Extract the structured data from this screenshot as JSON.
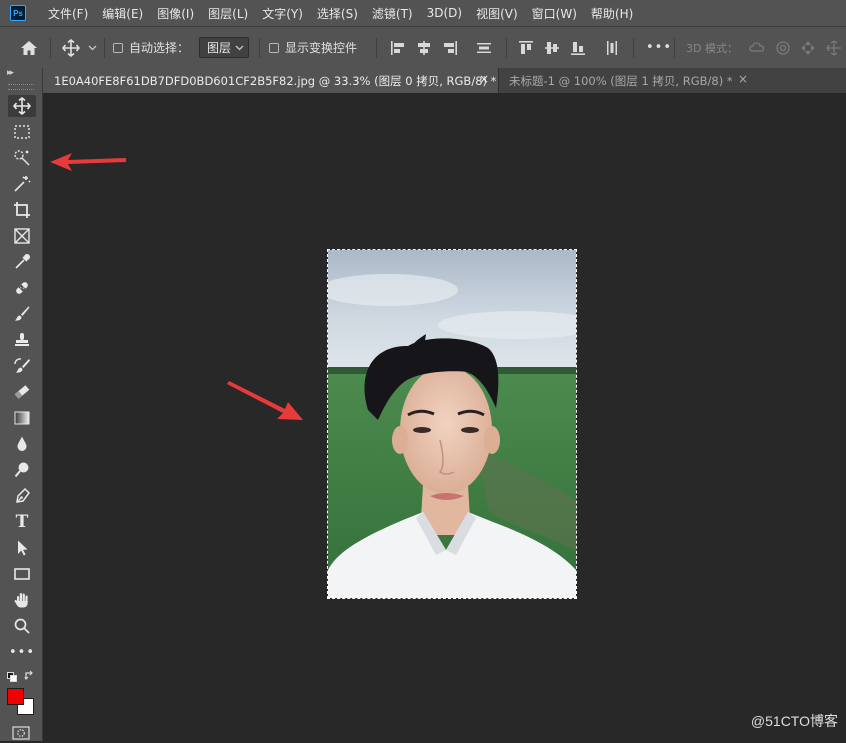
{
  "app": {
    "logo_text": "Ps"
  },
  "menu": [
    "文件(F)",
    "编辑(E)",
    "图像(I)",
    "图层(L)",
    "文字(Y)",
    "选择(S)",
    "滤镜(T)",
    "3D(D)",
    "视图(V)",
    "窗口(W)",
    "帮助(H)"
  ],
  "options": {
    "auto_select_label": "自动选择：",
    "auto_select_target": "图层",
    "show_transform_label": "显示变换控件",
    "more_label": "•••",
    "mode_3d_label": "3D 模式："
  },
  "tabs": [
    {
      "title": "1E0A40FE8F61DB7DFD0BD601CF2B5F82.jpg @ 33.3% (图层 0 拷贝, RGB/8) *",
      "close": "×"
    },
    {
      "title": "未标题-1 @ 100% (图层 1 拷贝, RGB/8) *",
      "close": "×"
    }
  ],
  "toolbar": {
    "collapse": "▸▸",
    "tools": [
      "move-icon",
      "rect-marquee-icon",
      "quick-selection-icon",
      "magic-wand-icon",
      "crop-icon",
      "frame-icon",
      "eyedropper-icon",
      "healing-brush-icon",
      "brush-icon",
      "clone-stamp-icon",
      "history-brush-icon",
      "eraser-icon",
      "gradient-icon",
      "blur-icon",
      "dodge-icon",
      "pen-icon",
      "type-icon",
      "path-selection-icon",
      "rectangle-icon",
      "hand-icon",
      "zoom-icon",
      "more-tools-icon"
    ],
    "type_glyph": "T",
    "more_glyph": "•••",
    "foreground_color": "#f00000",
    "background_color": "#ffffff"
  },
  "annotations": {
    "arrow_color": "#e83a3a"
  },
  "watermark": "@51CTO博客"
}
